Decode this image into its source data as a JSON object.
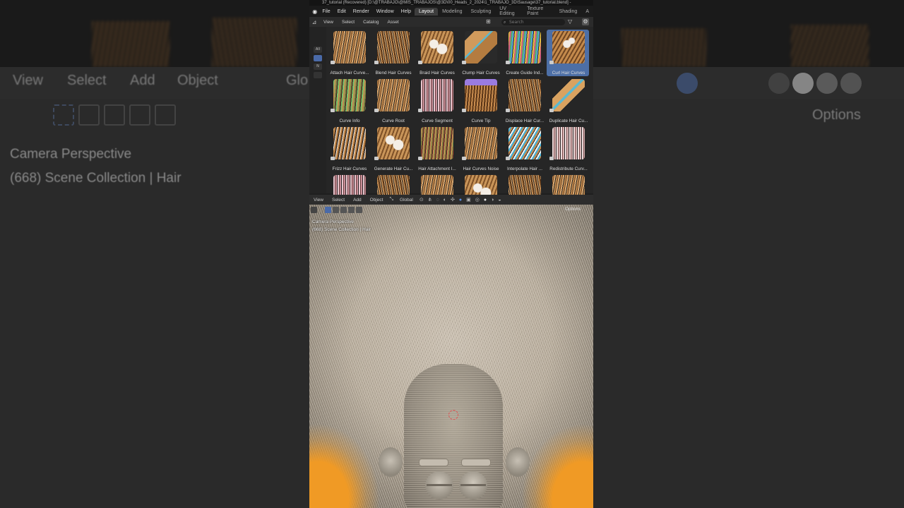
{
  "window": {
    "title": "37_tutorial (Recovered) [D:\\@TRABAJO\\@MIS_TRABAJOS\\@3D\\00_Heads_2_2024\\1_TRABAJO_3D\\Sausage\\37_tutorial.blend] - "
  },
  "menubar": {
    "items": [
      "File",
      "Edit",
      "Render",
      "Window",
      "Help"
    ],
    "workspaces": [
      "Layout",
      "Modeling",
      "Sculpting",
      "UV Editing",
      "Texture Paint",
      "Shading",
      "A"
    ],
    "active_workspace": "Layout"
  },
  "asset_browser": {
    "menu": [
      "View",
      "Select",
      "Catalog",
      "Asset"
    ],
    "search_placeholder": "Search",
    "side_tabs": [
      "All",
      "N",
      "",
      ""
    ],
    "assets": [
      {
        "label": "Attach Hair Curve...",
        "style": "h-brown"
      },
      {
        "label": "Blend Hair Curves",
        "style": "h-brown2"
      },
      {
        "label": "Braid Hair Curves",
        "style": "h-white"
      },
      {
        "label": "Clump Hair Curves",
        "style": "h-clump"
      },
      {
        "label": "Create Guide Ind...",
        "style": "h-color"
      },
      {
        "label": "Curl Hair Curves",
        "style": "h-curl",
        "selected": true
      },
      {
        "label": "Curve Info",
        "style": "h-green"
      },
      {
        "label": "Curve Root",
        "style": "h-brown"
      },
      {
        "label": "Curve Segment",
        "style": "h-pink"
      },
      {
        "label": "Curve Tip",
        "style": "h-tip"
      },
      {
        "label": "Displace Hair Cur...",
        "style": "h-brown2"
      },
      {
        "label": "Duplicate Hair Cu...",
        "style": "h-wave"
      },
      {
        "label": "Frizz Hair Curves",
        "style": "h-frizz"
      },
      {
        "label": "Generate Hair Cu...",
        "style": "h-white"
      },
      {
        "label": "Hair Attachment I...",
        "style": "h-red"
      },
      {
        "label": "Hair Curves Noise",
        "style": "h-brown"
      },
      {
        "label": "Interpolate Hair ...",
        "style": "h-blue"
      },
      {
        "label": "Redistribute Curv...",
        "style": "h-redis"
      },
      {
        "label": "",
        "style": "h-pink"
      },
      {
        "label": "",
        "style": "h-brown2"
      },
      {
        "label": "",
        "style": "h-brown"
      },
      {
        "label": "",
        "style": "h-white"
      },
      {
        "label": "",
        "style": "h-brown2"
      },
      {
        "label": "",
        "style": "h-brown"
      }
    ]
  },
  "viewport": {
    "menu": [
      "View",
      "Select",
      "Add",
      "Object"
    ],
    "orientation": "Global",
    "options_label": "Options",
    "camera_line1": "Camera Perspective",
    "camera_line2": "(668) Scene Collection | Hair"
  },
  "background": {
    "menu": [
      "View",
      "Select",
      "Add",
      "Object",
      "Glo"
    ],
    "options_label": "Options",
    "camera_line1": "Camera Perspective",
    "camera_line2": "(668) Scene Collection | Hair"
  }
}
